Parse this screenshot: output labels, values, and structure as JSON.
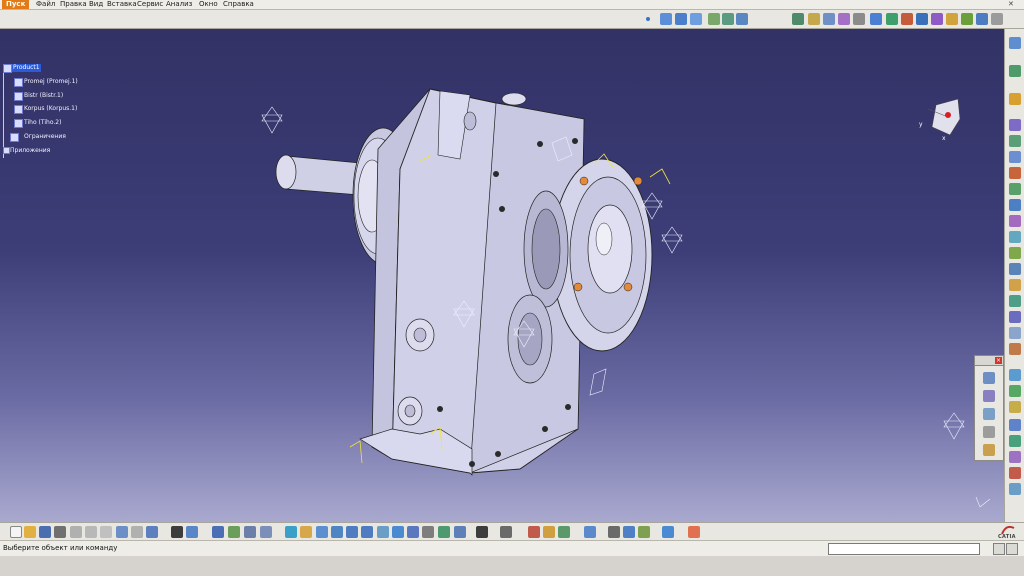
{
  "menu": {
    "start": "Пуск",
    "items": [
      "Файл",
      "Правка",
      "Вид",
      "Вставка",
      "Сервис",
      "Анализ",
      "Окно",
      "Справка"
    ]
  },
  "tree": {
    "root": "Product1",
    "children": [
      "Promej (Promej.1)",
      "Bistr (Bistr.1)",
      "Korpus (Korpus.1)",
      "Tiho (Tiho.2)",
      "Ограничения",
      "Приложения"
    ]
  },
  "compass": {
    "x_label": "x",
    "y_label": "y"
  },
  "status": {
    "message": "Выберите объект или команду",
    "command_value": ""
  },
  "brand": {
    "logo_text": "CATIA"
  },
  "colors": {
    "viewport_top": "#323266",
    "viewport_bottom": "#a9a9cf",
    "selection": "#2b5bd8",
    "accent": "#e07b18"
  }
}
